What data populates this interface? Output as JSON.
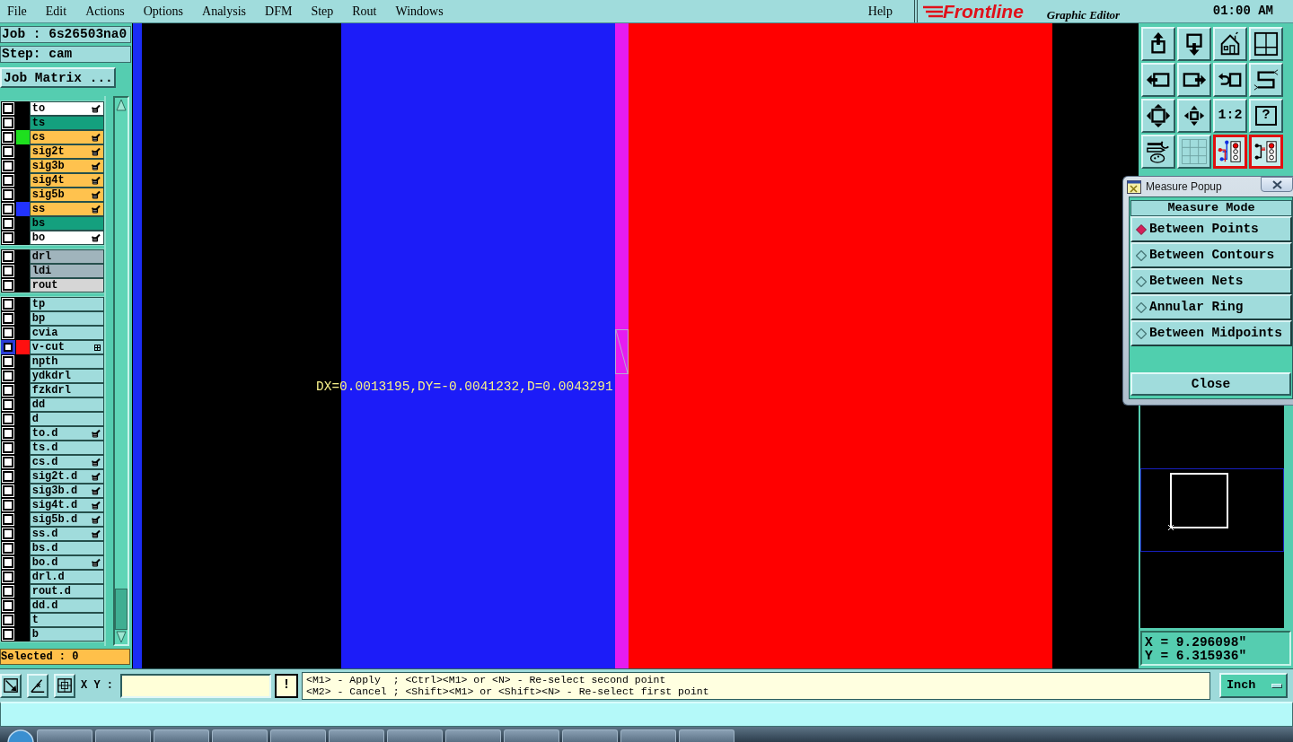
{
  "menu_bar": {
    "items": [
      "File",
      "Edit",
      "Actions",
      "Options",
      "Analysis",
      "DFM",
      "Step",
      "Rout",
      "Windows"
    ],
    "help": "Help",
    "logo": "Frontline",
    "subtitle": "Graphic Editor",
    "time": "01:00 AM"
  },
  "job_panel": {
    "job": "Job : 6s26503na0",
    "step": "Step: cam",
    "matrix_button": "Job Matrix ...",
    "layer_groups": [
      {
        "layers": [
          {
            "name": "to",
            "color": "#ffffff",
            "checked": false,
            "highlighted": false,
            "hand_mark": true,
            "grid_mark": false
          },
          {
            "name": "ts",
            "color": "#14a07e",
            "checked": false,
            "highlighted": false,
            "hand_mark": false,
            "grid_mark": false
          },
          {
            "name": "cs",
            "color": "#ffc24e",
            "checked": false,
            "highlighted": false,
            "hand_mark": true,
            "grid_mark": false,
            "swatch": {
              "color": "#1ee01e"
            }
          },
          {
            "name": "sig2t",
            "color": "#ffc24e",
            "checked": false,
            "highlighted": false,
            "hand_mark": true,
            "grid_mark": false
          },
          {
            "name": "sig3b",
            "color": "#ffc24e",
            "checked": false,
            "highlighted": false,
            "hand_mark": true,
            "grid_mark": false
          },
          {
            "name": "sig4t",
            "color": "#ffc24e",
            "checked": false,
            "highlighted": false,
            "hand_mark": true,
            "grid_mark": false
          },
          {
            "name": "sig5b",
            "color": "#ffc24e",
            "checked": false,
            "highlighted": false,
            "hand_mark": true,
            "grid_mark": false
          },
          {
            "name": "ss",
            "color": "#ffc24e",
            "checked": false,
            "highlighted": false,
            "hand_mark": true,
            "grid_mark": false,
            "swatch": {
              "color": "#2233ff"
            }
          },
          {
            "name": "bs",
            "color": "#14a07e",
            "checked": false,
            "highlighted": false,
            "hand_mark": false,
            "grid_mark": false
          },
          {
            "name": "bo",
            "color": "#ffffff",
            "checked": false,
            "highlighted": false,
            "hand_mark": true,
            "grid_mark": false
          }
        ]
      },
      {
        "layers": [
          {
            "name": "drl",
            "color": "#a0b4bc",
            "checked": false,
            "highlighted": false,
            "hand_mark": false,
            "grid_mark": false
          },
          {
            "name": "ldi",
            "color": "#a0b4bc",
            "checked": false,
            "highlighted": false,
            "hand_mark": false,
            "grid_mark": false
          },
          {
            "name": "rout",
            "color": "#d6d6d6",
            "checked": false,
            "highlighted": false,
            "hand_mark": false,
            "grid_mark": false
          }
        ]
      },
      {
        "layers": [
          {
            "name": "tp",
            "color": "#a0dcdc",
            "checked": false,
            "highlighted": false,
            "hand_mark": false,
            "grid_mark": false
          },
          {
            "name": "bp",
            "color": "#a0dcdc",
            "checked": false,
            "highlighted": false,
            "hand_mark": false,
            "grid_mark": false
          },
          {
            "name": "cvia",
            "color": "#a0dcdc",
            "checked": false,
            "highlighted": false,
            "hand_mark": false,
            "grid_mark": false
          },
          {
            "name": "v-cut",
            "color": "#a0dcdc",
            "checked": false,
            "highlighted": true,
            "hand_mark": false,
            "grid_mark": true,
            "swatch": {
              "color": "#ff1010"
            }
          },
          {
            "name": "npth",
            "color": "#a0dcdc",
            "checked": false,
            "highlighted": false,
            "hand_mark": false,
            "grid_mark": false
          },
          {
            "name": "ydkdrl",
            "color": "#a0dcdc",
            "checked": false,
            "highlighted": false,
            "hand_mark": false,
            "grid_mark": false
          },
          {
            "name": "fzkdrl",
            "color": "#a0dcdc",
            "checked": false,
            "highlighted": false,
            "hand_mark": false,
            "grid_mark": false
          },
          {
            "name": "dd",
            "color": "#a0dcdc",
            "checked": false,
            "highlighted": false,
            "hand_mark": false,
            "grid_mark": false
          },
          {
            "name": "d",
            "color": "#a0dcdc",
            "checked": false,
            "highlighted": false,
            "hand_mark": false,
            "grid_mark": false
          },
          {
            "name": "to.d",
            "color": "#a0dcdc",
            "checked": false,
            "highlighted": false,
            "hand_mark": true,
            "grid_mark": false
          },
          {
            "name": "ts.d",
            "color": "#a0dcdc",
            "checked": false,
            "highlighted": false,
            "hand_mark": false,
            "grid_mark": false
          },
          {
            "name": "cs.d",
            "color": "#a0dcdc",
            "checked": false,
            "highlighted": false,
            "hand_mark": true,
            "grid_mark": false
          },
          {
            "name": "sig2t.d",
            "color": "#a0dcdc",
            "checked": false,
            "highlighted": false,
            "hand_mark": true,
            "grid_mark": false
          },
          {
            "name": "sig3b.d",
            "color": "#a0dcdc",
            "checked": false,
            "highlighted": false,
            "hand_mark": true,
            "grid_mark": false
          },
          {
            "name": "sig4t.d",
            "color": "#a0dcdc",
            "checked": false,
            "highlighted": false,
            "hand_mark": true,
            "grid_mark": false
          },
          {
            "name": "sig5b.d",
            "color": "#a0dcdc",
            "checked": false,
            "highlighted": false,
            "hand_mark": true,
            "grid_mark": false
          },
          {
            "name": "ss.d",
            "color": "#a0dcdc",
            "checked": false,
            "highlighted": false,
            "hand_mark": true,
            "grid_mark": false
          },
          {
            "name": "bs.d",
            "color": "#a0dcdc",
            "checked": false,
            "highlighted": false,
            "hand_mark": false,
            "grid_mark": false
          },
          {
            "name": "bo.d",
            "color": "#a0dcdc",
            "checked": false,
            "highlighted": false,
            "hand_mark": true,
            "grid_mark": false
          },
          {
            "name": "drl.d",
            "color": "#a0dcdc",
            "checked": false,
            "highlighted": false,
            "hand_mark": false,
            "grid_mark": false
          },
          {
            "name": "rout.d",
            "color": "#a0dcdc",
            "checked": false,
            "highlighted": false,
            "hand_mark": false,
            "grid_mark": false
          },
          {
            "name": "dd.d",
            "color": "#a0dcdc",
            "checked": false,
            "highlighted": false,
            "hand_mark": false,
            "grid_mark": false
          },
          {
            "name": "t",
            "color": "#a0dcdc",
            "checked": false,
            "highlighted": false,
            "hand_mark": false,
            "grid_mark": false
          },
          {
            "name": "b",
            "color": "#a0dcdc",
            "checked": false,
            "highlighted": false,
            "hand_mark": false,
            "grid_mark": false
          }
        ]
      }
    ],
    "selected_count": "Selected : 0"
  },
  "canvas": {
    "readout": "DX=0.0013195,DY=-0.0041232,D=0.0043291"
  },
  "toolbar": [
    {
      "kind": "move-up",
      "highlighted": false
    },
    {
      "kind": "move-down",
      "highlighted": false
    },
    {
      "kind": "home",
      "highlighted": false
    },
    {
      "kind": "grid-frame",
      "highlighted": false
    },
    {
      "kind": "move-left",
      "highlighted": false
    },
    {
      "kind": "move-right",
      "highlighted": false
    },
    {
      "kind": "undo",
      "highlighted": false
    },
    {
      "kind": "zigzag",
      "highlighted": false
    },
    {
      "kind": "expand",
      "highlighted": false
    },
    {
      "kind": "pan",
      "highlighted": false
    },
    {
      "kind": "scale",
      "label": "1:2",
      "highlighted": false
    },
    {
      "kind": "help",
      "label": "?",
      "highlighted": false
    },
    {
      "kind": "tools",
      "highlighted": false
    },
    {
      "kind": "grid",
      "highlighted": false
    },
    {
      "kind": "net-colored",
      "highlighted": true
    },
    {
      "kind": "net-mono",
      "highlighted": true
    }
  ],
  "measure_popup": {
    "title": "Measure Popup",
    "heading": "Measure Mode",
    "options": [
      {
        "label": "Between Points",
        "selected": true
      },
      {
        "label": "Between Contours",
        "selected": false
      },
      {
        "label": "Between Nets",
        "selected": false
      },
      {
        "label": "Annular Ring",
        "selected": false
      },
      {
        "label": "Between Midpoints",
        "selected": false
      }
    ],
    "close_button": "Close"
  },
  "overview": {
    "coordinates": [
      "X = 9.296098\"",
      "Y = 6.315936\""
    ]
  },
  "command_bar": {
    "xy_label": "X Y :",
    "alert_button": "!",
    "messages": [
      "<M1> - Apply  ; <Ctrl><M1> or <N> - Re-select second point",
      "<M2> - Cancel ; <Shift><M1> or <Shift><N> - Re-select first point"
    ],
    "units": "Inch"
  }
}
